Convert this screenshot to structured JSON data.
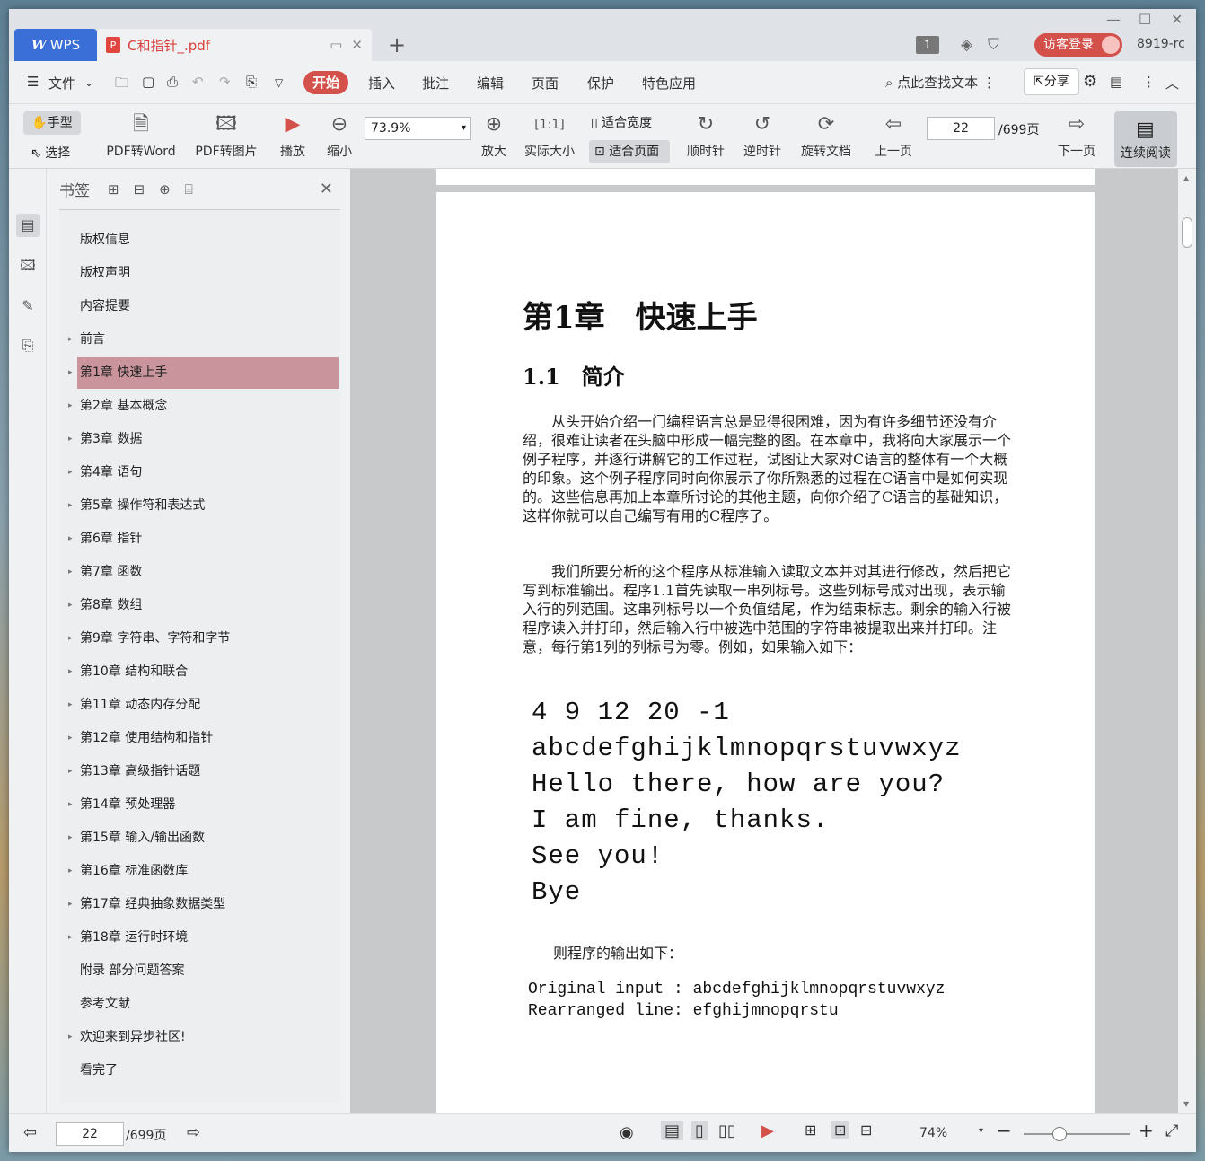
{
  "titlebar": {
    "app_tab": "WPS",
    "doc_tab": "C和指针_.pdf",
    "login": "访客登录",
    "build": "8919-rc",
    "count_badge": "1"
  },
  "menu": {
    "items": [
      "文件",
      "开始",
      "插入",
      "批注",
      "编辑",
      "页面",
      "保护",
      "特色应用"
    ],
    "search": "点此查找文本",
    "share": "分享"
  },
  "toolbar": {
    "hand": "手型",
    "select": "选择",
    "pdf_to_word": "PDF转Word",
    "pdf_to_img": "PDF转图片",
    "play": "播放",
    "zoom_out": "缩小",
    "zoom_value": "73.9%",
    "zoom_in": "放大",
    "actual_size": "实际大小",
    "fit_width": "适合宽度",
    "fit_page": "适合页面",
    "rotate_cw": "顺时针",
    "rotate_ccw": "逆时针",
    "rotate_doc": "旋转文档",
    "prev_page": "上一页",
    "page_value": "22",
    "page_total": "/699页",
    "next_page": "下一页",
    "continuous": "连续阅读"
  },
  "sidebar": {
    "title": "书签",
    "items": [
      {
        "label": "版权信息",
        "arrow": false
      },
      {
        "label": "版权声明",
        "arrow": false
      },
      {
        "label": "内容提要",
        "arrow": false
      },
      {
        "label": "前言",
        "arrow": true
      },
      {
        "label": "第1章 快速上手",
        "arrow": true
      },
      {
        "label": "第2章 基本概念",
        "arrow": true
      },
      {
        "label": "第3章 数据",
        "arrow": true
      },
      {
        "label": "第4章 语句",
        "arrow": true
      },
      {
        "label": "第5章 操作符和表达式",
        "arrow": true
      },
      {
        "label": "第6章 指针",
        "arrow": true
      },
      {
        "label": "第7章 函数",
        "arrow": true
      },
      {
        "label": "第8章 数组",
        "arrow": true
      },
      {
        "label": "第9章 字符串、字符和字节",
        "arrow": true
      },
      {
        "label": "第10章 结构和联合",
        "arrow": true
      },
      {
        "label": "第11章 动态内存分配",
        "arrow": true
      },
      {
        "label": "第12章 使用结构和指针",
        "arrow": true
      },
      {
        "label": "第13章 高级指针话题",
        "arrow": true
      },
      {
        "label": "第14章 预处理器",
        "arrow": true
      },
      {
        "label": "第15章 输入/输出函数",
        "arrow": true
      },
      {
        "label": "第16章 标准函数库",
        "arrow": true
      },
      {
        "label": "第17章 经典抽象数据类型",
        "arrow": true
      },
      {
        "label": "第18章 运行时环境",
        "arrow": true
      },
      {
        "label": "附录 部分问题答案",
        "arrow": false
      },
      {
        "label": "参考文献",
        "arrow": false
      },
      {
        "label": "欢迎来到异步社区!",
        "arrow": true
      },
      {
        "label": "看完了",
        "arrow": false
      }
    ],
    "active_index": 4
  },
  "document": {
    "chapter": "第1章　快速上手",
    "section": "1.1　简介",
    "para1": "从头开始介绍一门编程语言总是显得很困难，因为有许多细节还没有介绍，很难让读者在头脑中形成一幅完整的图。在本章中，我将向大家展示一个例子程序，并逐行讲解它的工作过程，试图让大家对C语言的整体有一个大概的印象。这个例子程序同时向你展示了你所熟悉的过程在C语言中是如何实现的。这些信息再加上本章所讨论的其他主题，向你介绍了C语言的基础知识，这样你就可以自己编写有用的C程序了。",
    "para2": "我们所要分析的这个程序从标准输入读取文本并对其进行修改，然后把它写到标准输出。程序1.1首先读取一串列标号。这些列标号成对出现，表示输入行的列范围。这串列标号以一个负值结尾，作为结束标志。剩余的输入行被程序读入并打印，然后输入行中被选中范围的字符串被提取出来并打印。注意，每行第1列的列标号为零。例如，如果输入如下：",
    "input_lines": [
      "4 9 12 20 -1",
      "abcdefghijklmnopqrstuvwxyz",
      "Hello there, how are you?",
      "I am fine, thanks.",
      "See you!",
      "Bye"
    ],
    "output_intro": "则程序的输出如下：",
    "output_lines": [
      "Original input : abcdefghijklmnopqrstuvwxyz",
      "Rearranged line: efghijmnopqrstu"
    ]
  },
  "status": {
    "page": "22",
    "total": "/699页",
    "zoom": "74%"
  },
  "colors": {
    "accent": "#d4504a",
    "active_bookmark": "#c9949b"
  }
}
